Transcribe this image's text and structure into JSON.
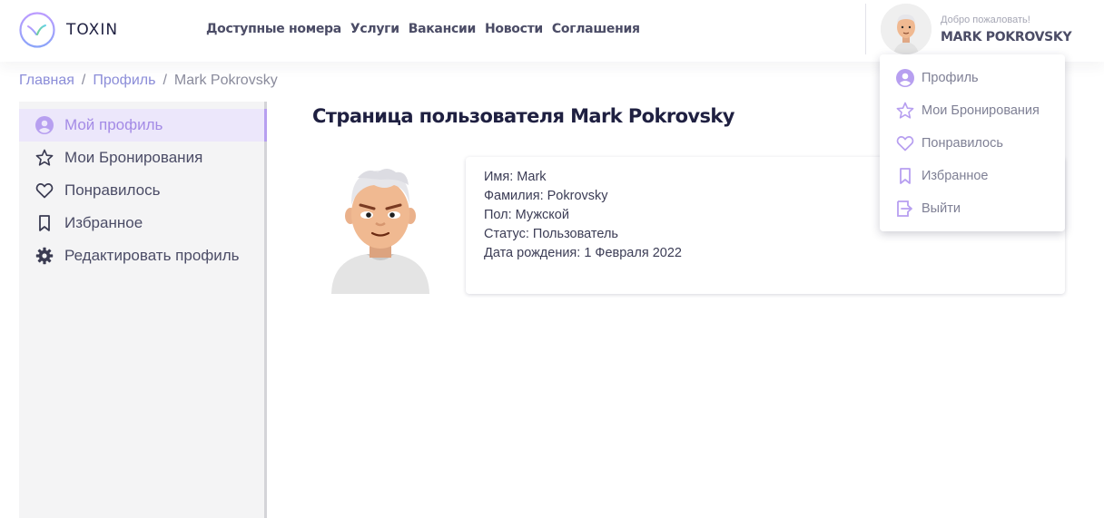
{
  "brand": {
    "name": "TOXIN"
  },
  "nav": {
    "items": [
      {
        "label": "Доступные номера"
      },
      {
        "label": "Услуги"
      },
      {
        "label": "Вакансии"
      },
      {
        "label": "Новости"
      },
      {
        "label": "Соглашения"
      }
    ]
  },
  "user": {
    "welcome": "Добро пожаловать!",
    "name": "MARK POKROVSKY"
  },
  "breadcrumb": {
    "home": "Главная",
    "profile": "Профиль",
    "current": "Mark Pokrovsky",
    "separator": "/"
  },
  "sidebar": {
    "items": [
      {
        "label": "Мой профиль",
        "icon": "user-circle-icon",
        "active": true
      },
      {
        "label": "Мои Бронирования",
        "icon": "star-icon"
      },
      {
        "label": "Понравилось",
        "icon": "heart-icon"
      },
      {
        "label": "Избранное",
        "icon": "bookmark-icon"
      },
      {
        "label": "Редактировать профиль",
        "icon": "gear-icon"
      }
    ]
  },
  "main": {
    "title": "Страница пользователя Mark Pokrovsky",
    "info": [
      "Имя: Mark",
      "Фамилия: Pokrovsky",
      "Пол: Мужской",
      "Статус: Пользователь",
      "Дата рождения: 1 Февраля 2022"
    ]
  },
  "dropdown": {
    "items": [
      {
        "label": "Профиль",
        "icon": "user-circle-icon"
      },
      {
        "label": "Мои Бронирования",
        "icon": "star-icon"
      },
      {
        "label": "Понравилось",
        "icon": "heart-icon"
      },
      {
        "label": "Избранное",
        "icon": "bookmark-icon"
      },
      {
        "label": "Выйти",
        "icon": "logout-icon"
      }
    ]
  },
  "colors": {
    "accent": "#bc9cff",
    "accent_alt": "#8ba4f9",
    "text_dark": "#1f2041"
  }
}
